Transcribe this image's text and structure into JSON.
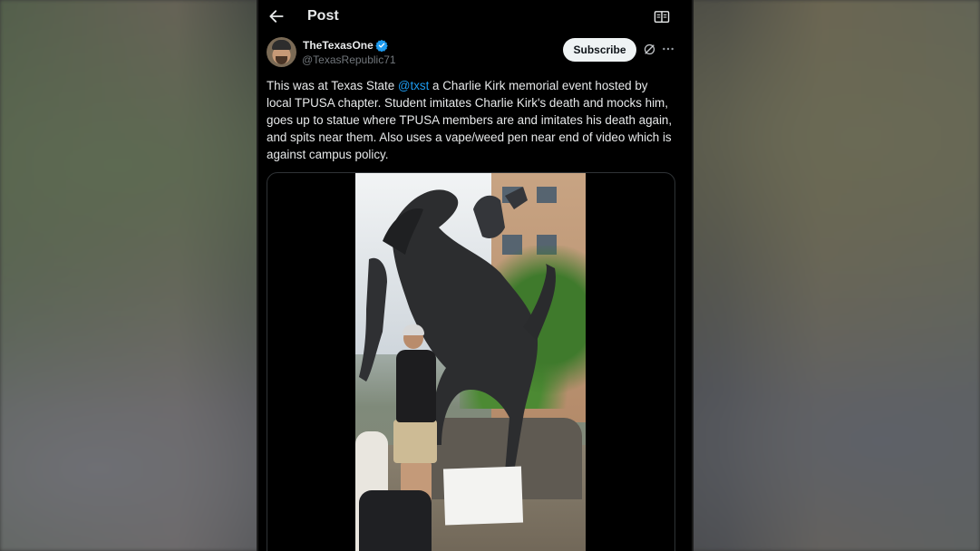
{
  "header": {
    "back_icon": "arrow-left-icon",
    "title": "Post",
    "reader_icon": "reader-mode-icon"
  },
  "author": {
    "display_name": "TheTexasOne",
    "handle": "@TexasRepublic71",
    "verified_icon": "verified-badge-icon",
    "verified_color": "#1d9bf0"
  },
  "actions": {
    "subscribe_label": "Subscribe",
    "grok_icon": "grok-icon",
    "more_icon": "more-horizontal-icon"
  },
  "post": {
    "text_before_mention": "This was at Texas State ",
    "mention": "@txst",
    "text_after_mention": " a Charlie Kirk memorial event hosted by local TPUSA chapter. Student imitates Charlie Kirk's death and mocks him, goes up to statue where TPUSA members are and imitates his death again, and spits near them. Also uses a vape/weed pen near end of video which is against campus policy.",
    "mention_color": "#1d9bf0"
  },
  "media": {
    "type": "video",
    "description_icon": "video-thumbnail"
  },
  "colors": {
    "background": "#000000",
    "text": "#e7e9ea",
    "secondary_text": "#71767b",
    "subscribe_bg": "#eff3f4"
  }
}
